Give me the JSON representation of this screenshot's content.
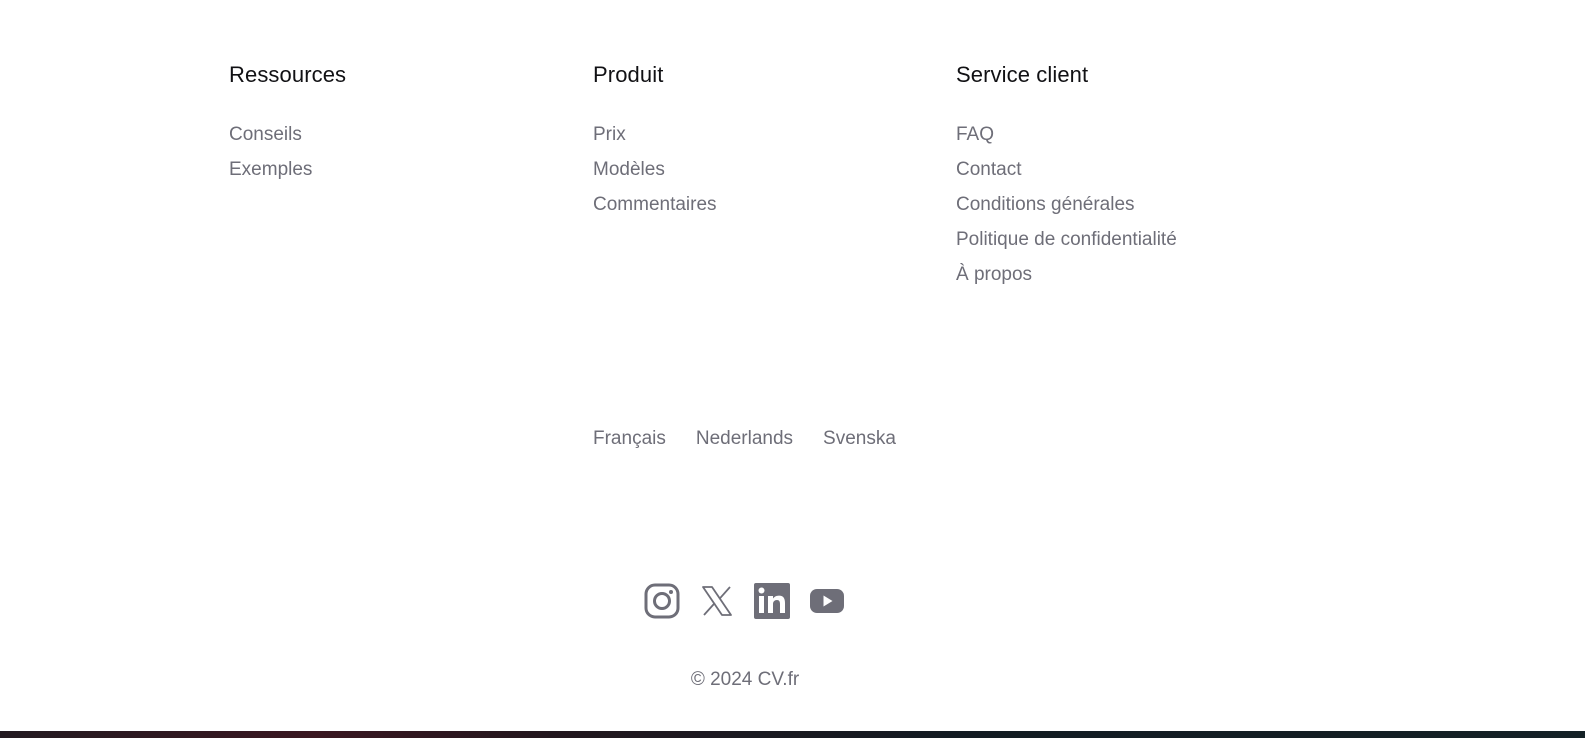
{
  "columns": [
    {
      "title": "Ressources",
      "links": [
        "Conseils",
        "Exemples"
      ]
    },
    {
      "title": "Produit",
      "links": [
        "Prix",
        "Modèles",
        "Commentaires"
      ]
    },
    {
      "title": "Service client",
      "links": [
        "FAQ",
        "Contact",
        "Conditions générales",
        "Politique de confidentialité",
        "À propos"
      ]
    }
  ],
  "languages": [
    "Français",
    "Nederlands",
    "Svenska"
  ],
  "social": [
    {
      "icon": "instagram-icon"
    },
    {
      "icon": "x-icon"
    },
    {
      "icon": "linkedin-icon"
    },
    {
      "icon": "youtube-icon"
    }
  ],
  "copyright": "© 2024 CV.fr",
  "colors": {
    "title": "#111114",
    "link": "#6e6e78",
    "icon": "#6e6e78"
  }
}
